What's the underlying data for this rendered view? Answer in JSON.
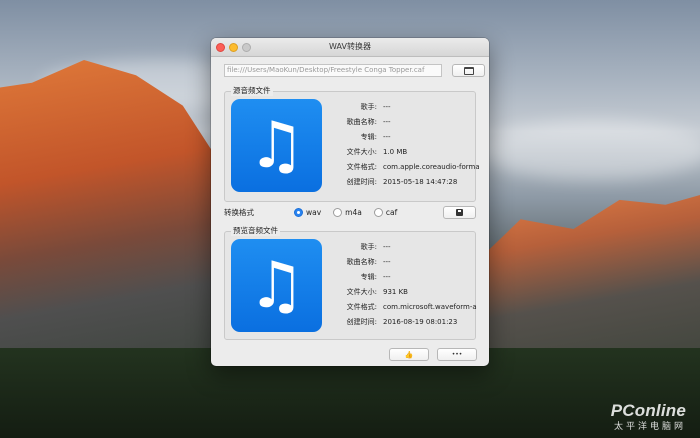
{
  "window": {
    "title": "WAV转换器"
  },
  "path_field": {
    "value": "file:///Users/MaoKun/Desktop/Freestyle Conga Topper.caf"
  },
  "icons": {
    "folder": "folder-icon",
    "save": "floppy-disk-icon",
    "music": "music-note-icon",
    "thumb": "thumbs-up-icon",
    "more": "ellipsis-icon"
  },
  "source": {
    "title": "源音频文件",
    "fields": [
      {
        "label": "歌手:",
        "value": "---"
      },
      {
        "label": "歌曲名称:",
        "value": "---"
      },
      {
        "label": "专辑:",
        "value": "---"
      },
      {
        "label": "文件大小:",
        "value": "1.0 MB"
      },
      {
        "label": "文件格式:",
        "value": "com.apple.coreaudio-forma"
      },
      {
        "label": "创建时间:",
        "value": "2015-05-18 14:47:28"
      }
    ]
  },
  "convert": {
    "label": "转换格式",
    "options": [
      {
        "label": "wav",
        "selected": true
      },
      {
        "label": "m4a",
        "selected": false
      },
      {
        "label": "caf",
        "selected": false
      }
    ]
  },
  "preview": {
    "title": "预览音频文件",
    "fields": [
      {
        "label": "歌手:",
        "value": "---"
      },
      {
        "label": "歌曲名称:",
        "value": "---"
      },
      {
        "label": "专辑:",
        "value": "---"
      },
      {
        "label": "文件大小:",
        "value": "931 KB"
      },
      {
        "label": "文件格式:",
        "value": "com.microsoft.waveform-a"
      },
      {
        "label": "创建时间:",
        "value": "2016-08-19 08:01:23"
      }
    ]
  },
  "buttons": {
    "thumb_glyph": "👍",
    "more_glyph": "•••"
  },
  "watermark": {
    "logo": "PConline",
    "sub": "太平洋电脑网"
  },
  "colors": {
    "accent": "#2b84f0",
    "icon_blue": "#1f8ef1",
    "close": "#fc5f57",
    "minimize": "#fdbc2e"
  }
}
